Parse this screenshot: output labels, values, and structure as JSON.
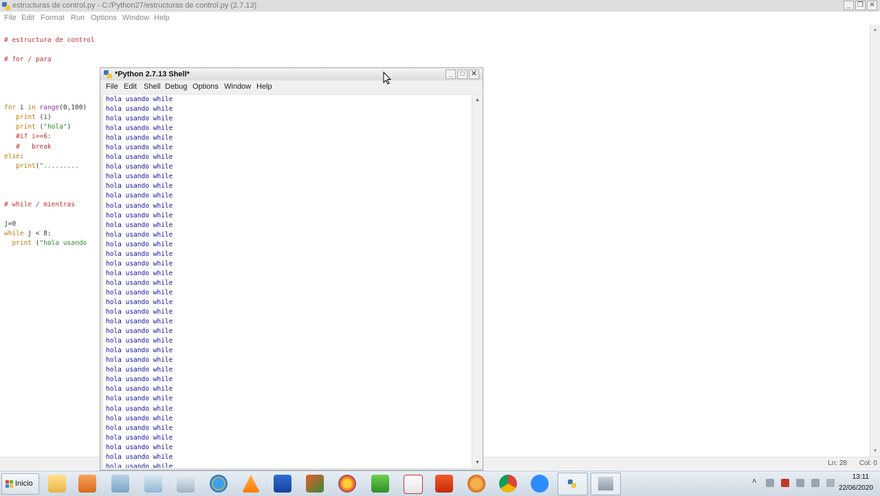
{
  "editor": {
    "title": "estructuras de control.py - C:/Python27/estructuras de control.py (2.7.13)",
    "menu": [
      "File",
      "Edit",
      "Format",
      "Run",
      "Options",
      "Window",
      "Help"
    ],
    "status": {
      "line": "Ln: 28",
      "col": "Col: 0"
    }
  },
  "shell": {
    "title": "*Python 2.7.13 Shell*",
    "menu": [
      "File",
      "Edit",
      "Shell",
      "Debug",
      "Options",
      "Window",
      "Help"
    ],
    "output_line": "hola usando while",
    "visible_line_count": 39
  },
  "taskbar": {
    "start_label": "Inicio",
    "time": "13:11",
    "date": "22/06/2020",
    "pinned": [
      "explorer-icon",
      "media-player-icon",
      "app-icon",
      "paint-icon",
      "calculator-icon",
      "internet-explorer-icon",
      "vlc-icon",
      "app-icon",
      "app-icon",
      "firefox-icon",
      "app-icon",
      "acrobat-icon",
      "app-icon",
      "app-icon",
      "chrome-icon",
      "zoom-icon",
      "python-icon",
      "app-icon"
    ]
  }
}
